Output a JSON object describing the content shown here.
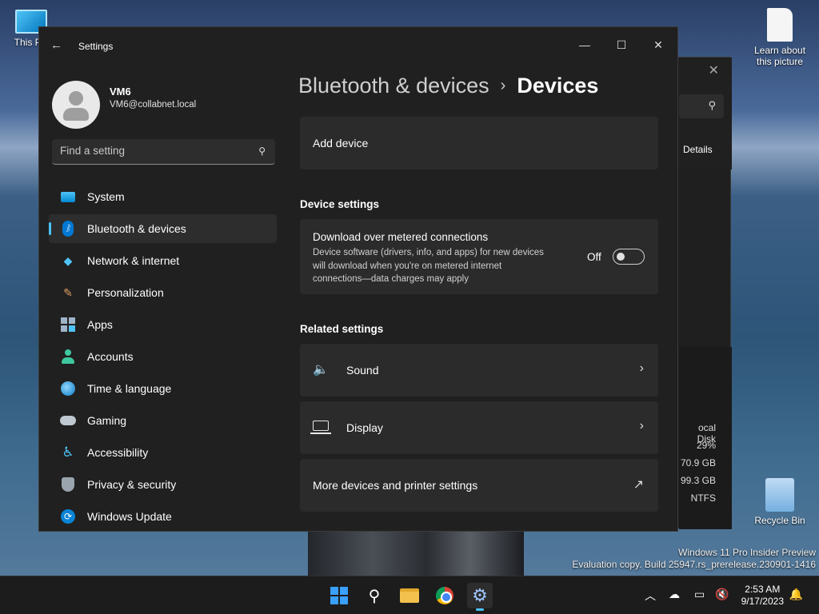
{
  "desktop": {
    "icons": [
      {
        "label": "This PC"
      },
      {
        "label": "Learn about this picture"
      },
      {
        "label": "Recycle Bin"
      }
    ],
    "watermark": {
      "line1": "Windows 11 Pro Insider Preview",
      "line2": "Evaluation copy. Build 25947.rs_prerelease.230901-1416"
    }
  },
  "background_window": {
    "close_glyph": "✕",
    "details_label": "Details",
    "drive_label": "ocal Disk",
    "values": [
      "29%",
      "70.9 GB",
      "99.3 GB",
      "NTFS"
    ]
  },
  "settings": {
    "title": "Settings",
    "controls": {
      "minimize": "—",
      "maximize": "☐",
      "close": "✕",
      "back": "←"
    },
    "profile": {
      "name": "VM6",
      "email": "VM6@collabnet.local"
    },
    "search": {
      "placeholder": "Find a setting"
    },
    "nav": [
      {
        "label": "System",
        "icon": "system-icon"
      },
      {
        "label": "Bluetooth & devices",
        "icon": "bluetooth-icon",
        "active": true
      },
      {
        "label": "Network & internet",
        "icon": "wifi-icon"
      },
      {
        "label": "Personalization",
        "icon": "brush-icon"
      },
      {
        "label": "Apps",
        "icon": "apps-icon"
      },
      {
        "label": "Accounts",
        "icon": "accounts-icon"
      },
      {
        "label": "Time & language",
        "icon": "globe-clock-icon"
      },
      {
        "label": "Gaming",
        "icon": "gamepad-icon"
      },
      {
        "label": "Accessibility",
        "icon": "accessibility-icon"
      },
      {
        "label": "Privacy & security",
        "icon": "shield-icon"
      },
      {
        "label": "Windows Update",
        "icon": "update-icon"
      }
    ],
    "breadcrumb": {
      "parent": "Bluetooth & devices",
      "separator": "›",
      "current": "Devices"
    },
    "add_device": {
      "label": "Add device"
    },
    "device_settings": {
      "heading": "Device settings",
      "metered": {
        "title": "Download over metered connections",
        "description": "Device software (drivers, info, and apps) for new devices will download when you're on metered internet connections—data charges may apply",
        "state_label": "Off",
        "enabled": false
      }
    },
    "related_settings": {
      "heading": "Related settings",
      "items": [
        {
          "label": "Sound",
          "icon": "speaker-icon",
          "action": "›"
        },
        {
          "label": "Display",
          "icon": "laptop-icon",
          "action": "›"
        },
        {
          "label": "More devices and printer settings",
          "icon": "",
          "action": "↗"
        }
      ]
    }
  },
  "taskbar": {
    "clock": {
      "time": "2:53 AM",
      "date": "9/17/2023"
    },
    "tray_glyphs": {
      "chevron": "︿",
      "search": "⚲",
      "bell": "🔔"
    }
  },
  "colors": {
    "accent": "#4cc2ff",
    "window_bg": "#202020",
    "card_bg": "#2b2b2b"
  }
}
